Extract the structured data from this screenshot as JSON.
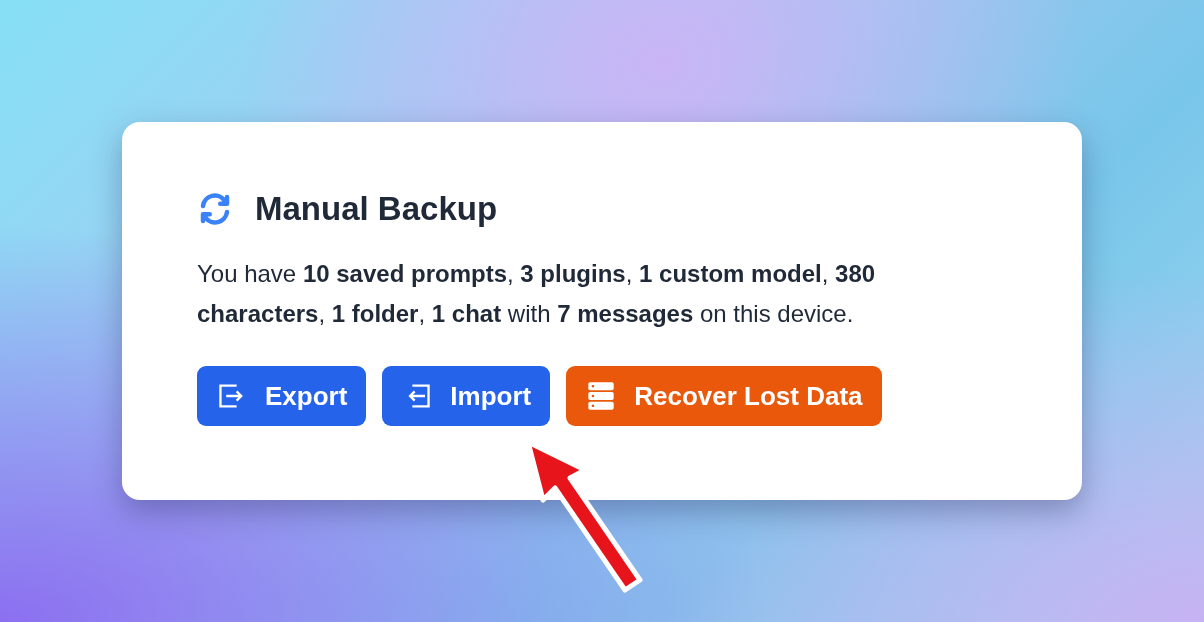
{
  "card": {
    "title": "Manual Backup",
    "summary": "You have **10 saved prompts**, **3 plugins**, **1 custom model**, **380 characters**, **1 folder**, **1 chat** with **7 messages** on this device.",
    "buttons": [
      {
        "label": "Export",
        "kind": "export"
      },
      {
        "label": "Import",
        "kind": "import"
      },
      {
        "label": "Recover Lost Data",
        "kind": "recover"
      }
    ]
  }
}
